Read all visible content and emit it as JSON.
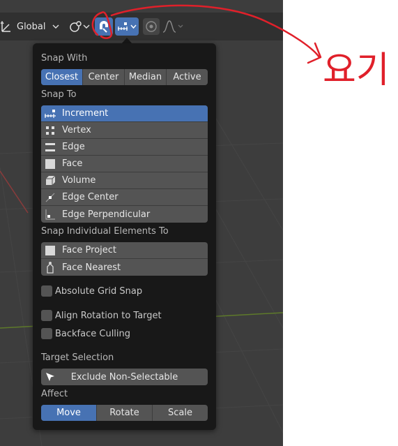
{
  "toolbar": {
    "orientation_label": "Global",
    "icons": {
      "orientation": "transform-orientation-icon",
      "pivot": "pivot-point-icon",
      "snap": "magnet-snap-icon",
      "snap_target": "increment-snap-icon",
      "proportional": "proportional-editing-icon",
      "falloff": "falloff-curve-icon"
    }
  },
  "popover": {
    "snap_with": {
      "label": "Snap With",
      "options": [
        "Closest",
        "Center",
        "Median",
        "Active"
      ],
      "selected": "Closest"
    },
    "snap_to": {
      "label": "Snap To",
      "items": [
        {
          "label": "Increment",
          "icon": "increment-icon",
          "active": true
        },
        {
          "label": "Vertex",
          "icon": "vertex-icon",
          "active": false
        },
        {
          "label": "Edge",
          "icon": "edge-icon",
          "active": false
        },
        {
          "label": "Face",
          "icon": "face-icon",
          "active": false
        },
        {
          "label": "Volume",
          "icon": "volume-icon",
          "active": false
        },
        {
          "label": "Edge Center",
          "icon": "edge-center-icon",
          "active": false
        },
        {
          "label": "Edge Perpendicular",
          "icon": "edge-perpendicular-icon",
          "active": false
        }
      ]
    },
    "snap_individual": {
      "label": "Snap Individual Elements To",
      "items": [
        {
          "label": "Face Project",
          "icon": "face-project-icon"
        },
        {
          "label": "Face Nearest",
          "icon": "face-nearest-icon"
        }
      ]
    },
    "checkboxes": {
      "absolute_grid": "Absolute Grid Snap",
      "align_rotation": "Align Rotation to Target",
      "backface": "Backface Culling"
    },
    "target_selection": {
      "label": "Target Selection",
      "button": "Exclude Non-Selectable"
    },
    "affect": {
      "label": "Affect",
      "options": [
        "Move",
        "Rotate",
        "Scale"
      ],
      "selected": "Move"
    }
  },
  "annotation": {
    "text": "요기",
    "color": "#e0202a"
  }
}
